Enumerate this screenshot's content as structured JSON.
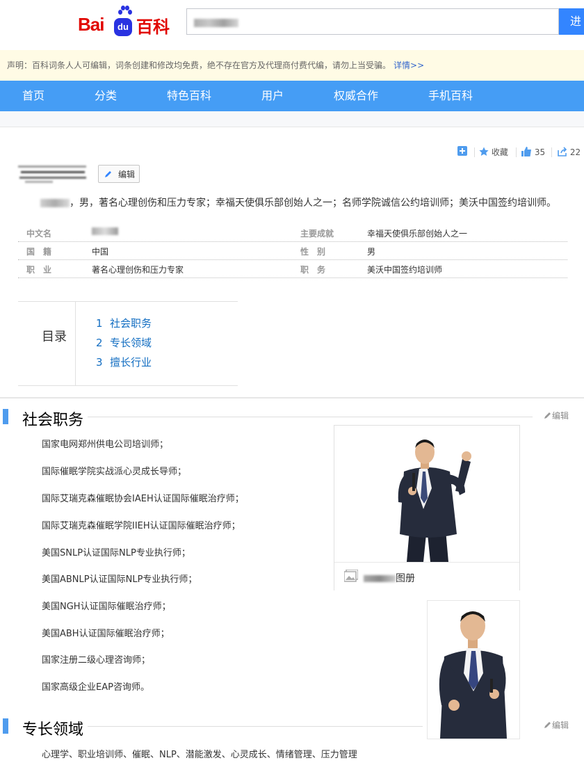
{
  "header": {
    "logo_text_bai": "Bai",
    "logo_text_du": "du",
    "logo_text_baike": "百科",
    "search_button": "进"
  },
  "notice": {
    "text": "声明：百科词条人人可编辑，词条创建和修改均免费，绝不存在官方及代理商付费代编，请勿上当受骗。",
    "link": "详情>>"
  },
  "nav": {
    "items": [
      "首页",
      "分类",
      "特色百科",
      "用户",
      "权威合作",
      "手机百科"
    ]
  },
  "toolbar": {
    "collect_label": "收藏",
    "like_count": "35",
    "share_count": "22"
  },
  "entry": {
    "edit_label": "编辑",
    "summary": "，男，著名心理创伤和压力专家；幸福天使俱乐部创始人之一；名师学院诚信公约培训师；美沃中国签约培训师。"
  },
  "basic_info": {
    "rows": [
      {
        "left_key": "中文名",
        "left_value": "",
        "right_key": "主要成就",
        "right_value": "幸福天使俱乐部创始人之一"
      },
      {
        "left_key": "国　籍",
        "left_value": "中国",
        "right_key": "性　别",
        "right_value": "男"
      },
      {
        "left_key": "职　业",
        "left_value": "著名心理创伤和压力专家",
        "right_key": "职　务",
        "right_value": "美沃中国签约培训师"
      }
    ]
  },
  "toc": {
    "label": "目录",
    "items": [
      {
        "num": "1",
        "title": "社会职务"
      },
      {
        "num": "2",
        "title": "专长领域"
      },
      {
        "num": "3",
        "title": "擅长行业"
      }
    ]
  },
  "sections": {
    "social": {
      "title": "社会职务",
      "edit_label": "编辑",
      "paragraphs": [
        "国家电网郑州供电公司培训师；",
        "国际催眠学院实战派心灵成长导师；",
        "国际艾瑞克森催眠协会IAEH认证国际催眠治疗师；",
        "国际艾瑞克森催眠学院IIEH认证国际催眠治疗师；",
        "美国SNLP认证国际NLP专业执行师；",
        "美国ABNLP认证国际NLP专业执行师；",
        "美国NGH认证国际催眠治疗师；",
        "美国ABH认证国际催眠治疗师；",
        "国家注册二级心理咨询师；",
        "国家高级企业EAP咨询师。"
      ]
    },
    "expertise": {
      "title": "专长领域",
      "edit_label": "编辑",
      "text": "心理学、职业培训师、催眠、NLP、潜能激发、心灵成长、情绪管理、压力管理"
    }
  },
  "album": {
    "caption_suffix": "图册"
  },
  "colors": {
    "nav_bg": "#459df5",
    "link": "#136ec2",
    "brand_red": "#e10601",
    "brand_blue": "#2932e1",
    "section_bar": "#4f9cee"
  }
}
